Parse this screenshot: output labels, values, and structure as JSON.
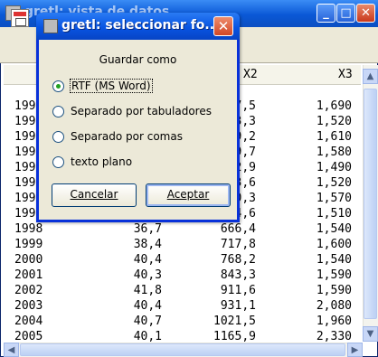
{
  "background_window": {
    "title": "gretl: vista de datos",
    "toolbar_icon": "save-icon",
    "columns": [
      "X2",
      "X3"
    ],
    "rows": [
      {
        "year": "199",
        "x1": "",
        "x2": "7,5",
        "x3": "1,690"
      },
      {
        "year": "199",
        "x1": "",
        "x2": "3,3",
        "x3": "1,520"
      },
      {
        "year": "199",
        "x1": "",
        "x2": "9,2",
        "x3": "1,610"
      },
      {
        "year": "199",
        "x1": "",
        "x2": "9,7",
        "x3": "1,580"
      },
      {
        "year": "199",
        "x1": "",
        "x2": "2,9",
        "x3": "1,490"
      },
      {
        "year": "199",
        "x1": "",
        "x2": "3,6",
        "x3": "1,520"
      },
      {
        "year": "199",
        "x1": "",
        "x2": "0,3",
        "x3": "1,570"
      },
      {
        "year": "199",
        "x1": "",
        "x2": "4,6",
        "x3": "1,510"
      },
      {
        "year": "1998",
        "x1": "36,7",
        "x2": "666,4",
        "x3": "1,540"
      },
      {
        "year": "1999",
        "x1": "38,4",
        "x2": "717,8",
        "x3": "1,600"
      },
      {
        "year": "2000",
        "x1": "40,4",
        "x2": "768,2",
        "x3": "1,540"
      },
      {
        "year": "2001",
        "x1": "40,3",
        "x2": "843,3",
        "x3": "1,590"
      },
      {
        "year": "2002",
        "x1": "41,8",
        "x2": "911,6",
        "x3": "1,590"
      },
      {
        "year": "2003",
        "x1": "40,4",
        "x2": "931,1",
        "x3": "2,080"
      },
      {
        "year": "2004",
        "x1": "40,7",
        "x2": "1021,5",
        "x3": "1,960"
      },
      {
        "year": "2005",
        "x1": "40,1",
        "x2": "1165,9",
        "x3": "2,330"
      }
    ]
  },
  "dialog": {
    "title": "gretl: seleccionar fo...",
    "caption": "Guardar como",
    "options": [
      {
        "label": "RTF (MS Word)",
        "selected": true
      },
      {
        "label": "Separado por tabuladores",
        "selected": false
      },
      {
        "label": "Separado por comas",
        "selected": false
      },
      {
        "label": "texto plano",
        "selected": false
      }
    ],
    "cancel_label": "Cancelar",
    "accept_label": "Aceptar"
  }
}
